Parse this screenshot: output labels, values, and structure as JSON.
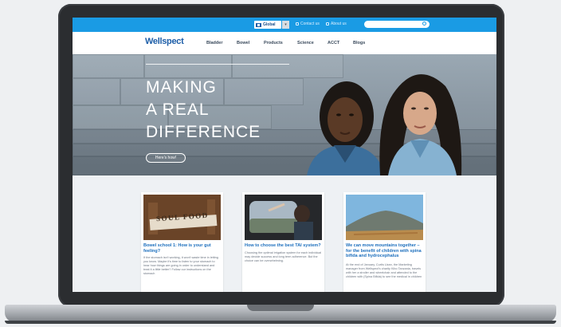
{
  "topbar": {
    "global_label": "Global",
    "contact_label": "Contact us",
    "about_label": "About us",
    "search_placeholder": ""
  },
  "nav": {
    "logo": "Wellspect",
    "items": [
      "Bladder",
      "Bowel",
      "Products",
      "Science",
      "ACCT",
      "Blogs"
    ]
  },
  "hero": {
    "line1": "MAKING",
    "line2": "A REAL",
    "line3": "DIFFERENCE",
    "button_label": "Here's how!"
  },
  "cards": [
    {
      "image_text": "SOUL FOOD",
      "title": "Bowel school 1: How is your gut feeling?",
      "body": "If the stomach isn't working, it won't waste time in letting you know. Maybe it's time to listen to your stomach to hear how things are going in order to understand and treat it a little better? Follow our instructions on the stomach"
    },
    {
      "title": "How to choose the best TAI system?",
      "body": "Choosing the optimal irrigation system for each individual may decide success and long term adherence. But the choice can be overwhelming."
    },
    {
      "title": "We can move mountains together – for the benefit of children with spina bifida and hydrocephalus",
      "body": "At the end of January, Curtis Uzan, the Marketing manager from Wellspect's charity Kibo Tanzania, travels with her a stroller and wheelchair and attended to the children with (Spina Bifida) to see the medical in children"
    }
  ],
  "colors": {
    "topbar": "#1a9be4",
    "logo": "#1d5ea8",
    "card_title": "#1d6fbd",
    "laptop_frame": "#2b2d30"
  }
}
